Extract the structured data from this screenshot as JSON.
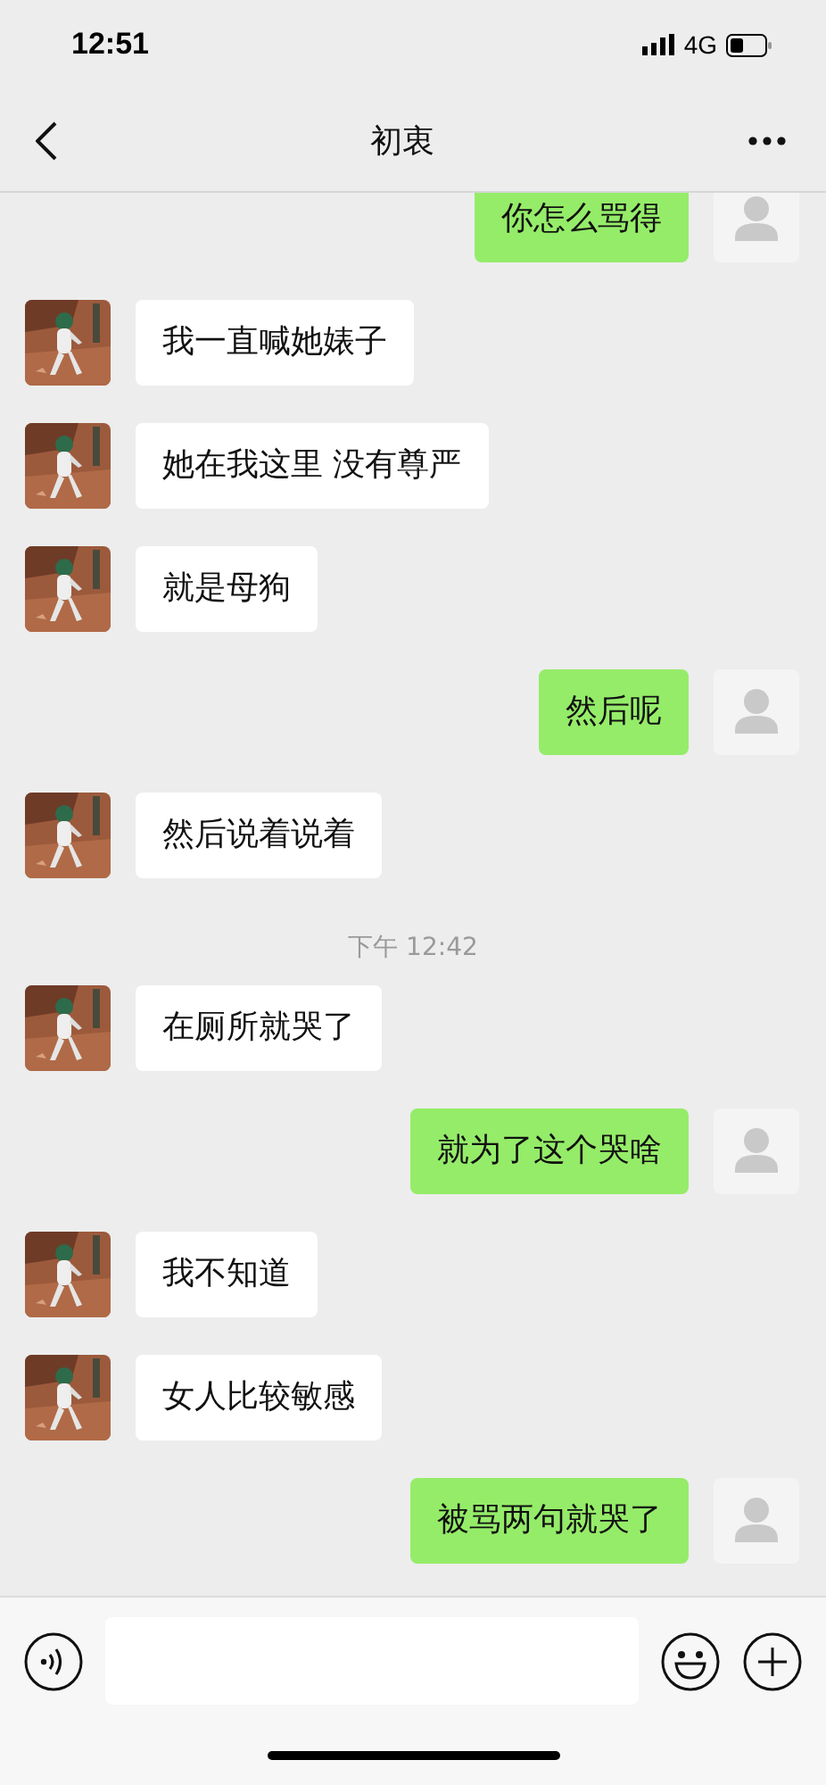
{
  "status_bar": {
    "time": "12:51",
    "network": "4G"
  },
  "nav_bar": {
    "title": "初衷"
  },
  "messages": [
    {
      "kind": "sent",
      "text": "你怎么骂得"
    },
    {
      "kind": "received",
      "text": "我一直喊她婊子"
    },
    {
      "kind": "received",
      "text": "她在我这里 没有尊严"
    },
    {
      "kind": "received",
      "text": "就是母狗"
    },
    {
      "kind": "sent",
      "text": "然后呢"
    },
    {
      "kind": "received",
      "text": "然后说着说着"
    },
    {
      "kind": "timestamp",
      "text": "下午 12:42"
    },
    {
      "kind": "received",
      "text": "在厕所就哭了"
    },
    {
      "kind": "sent",
      "text": "就为了这个哭啥"
    },
    {
      "kind": "received",
      "text": "我不知道"
    },
    {
      "kind": "received",
      "text": "女人比较敏感"
    },
    {
      "kind": "sent",
      "text": "被骂两句就哭了"
    }
  ]
}
